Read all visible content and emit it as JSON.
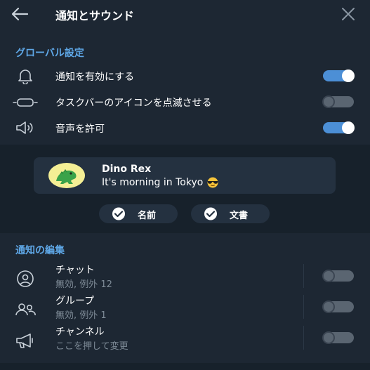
{
  "header": {
    "title": "通知とサウンド",
    "back_icon": "arrow-left-icon",
    "close_icon": "close-icon"
  },
  "global": {
    "section_title": "グローバル設定",
    "items": [
      {
        "label": "通知を有効にする",
        "icon": "bell-icon",
        "enabled": true
      },
      {
        "label": "タスクバーのアイコンを点滅させる",
        "icon": "taskbar-icon",
        "enabled": false
      },
      {
        "label": "音声を許可",
        "icon": "speaker-icon",
        "enabled": true
      }
    ]
  },
  "preview": {
    "name": "Dino Rex",
    "message": "It's morning in Tokyo",
    "emoji": "😎",
    "chips": [
      {
        "label": "名前",
        "checked": true
      },
      {
        "label": "文書",
        "checked": true
      }
    ]
  },
  "edit": {
    "section_title": "通知の編集",
    "items": [
      {
        "title": "チャット",
        "subtitle": "無効, 例外 12",
        "icon": "user-circle-icon",
        "enabled": false
      },
      {
        "title": "グループ",
        "subtitle": "無効, 例外 1",
        "icon": "group-icon",
        "enabled": false
      },
      {
        "title": "チャンネル",
        "subtitle": "ここを押して変更",
        "icon": "megaphone-icon",
        "enabled": false
      }
    ]
  },
  "colors": {
    "background": "#1d2733",
    "preview_background": "#17212b",
    "accent": "#5fa8e8",
    "toggle_on": "#4c8fd6"
  }
}
